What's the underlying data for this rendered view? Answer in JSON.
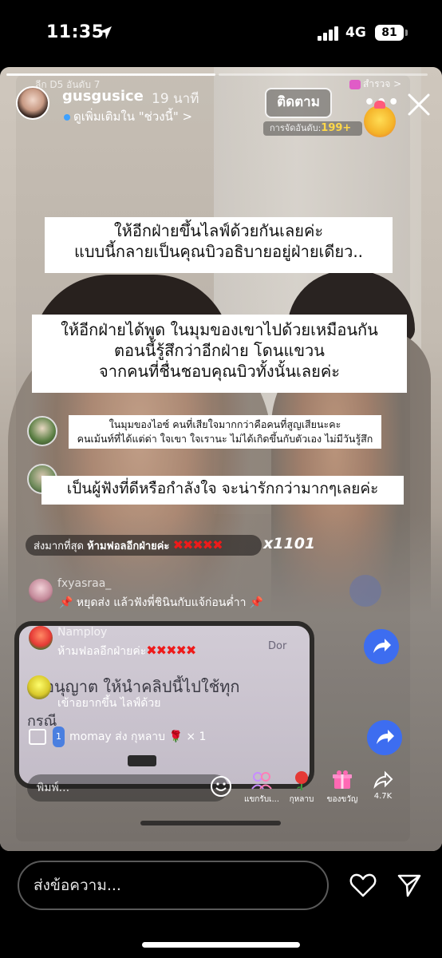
{
  "status_bar": {
    "time": "11:35",
    "network": "4G",
    "battery": "81"
  },
  "story": {
    "username": "gusgusice",
    "time_ago": "19 นาที",
    "subtitle": "ดูเพิ่มเติมใน \"ช่วงนี้\" >",
    "close_label": "×"
  },
  "live": {
    "league_ghost": "ลีก D5 อันดับ 7",
    "explore_label": "สำรวจ >",
    "follow_label": "ติดตาม",
    "more_label": "•••",
    "rank_label": "การจัดอันดับ:",
    "rank_value": "199+",
    "captions": [
      "ให้อีกฝ่ายขึ้นไลฟ์ด้วยกันเลยค่ะ\nแบบนี้กลายเป็นคุณบิวอธิบายอยู่ฝ่ายเดียว..",
      "ให้อีกฝ่ายได้พูด ในมุมของเขาไปด้วยเหมือนกัน\nตอนนี้รู้สึกว่าอีกฝ่าย โดนแขวน\nจากคนที่ชื่นชอบคุณบิวทั้งนั้นเลยค่ะ",
      "ในมุมของไอซ์ คนที่เสียใจมากกว่าคือคนที่สูญเสียนะคะ\nคนเม้นท์ที่ได้แต่ด่า ใจเขา ใจเรานะ ไม่ได้เกิดขึ้นกับตัวเอง ไม่มีวันรู้สึก",
      "เป็นผู้ฟังที่ดีหรือกำลังใจ จะน่ารักกว่ามากๆเลยค่ะ"
    ],
    "gift_banner": {
      "prefix": "ส่งมากที่สุด",
      "text": "ห้ามฟอลอีกฝ่ายค่ะ",
      "xs": "✖✖✖✖✖",
      "count": "x1101"
    },
    "comments": [
      {
        "name": "fxyasraa_",
        "text": "หยุดส่ง แล้วฟังพี่ชินินกับแจ้ก่อนค่ำา"
      },
      {
        "name": "Namploy",
        "text": "ห้ามฟอลอีกฝ่ายค่ะ",
        "xs": "✖✖✖✖✖"
      },
      {
        "name": "",
        "text": "เข้าอยากขึ้น ไลฟ์ด้วย"
      }
    ],
    "phone_screen": {
      "line1": "อนุญาต ให้นำคลิปนี้ไปใช้ทุก",
      "line2": "กรณี",
      "corner": "Dor"
    },
    "gift_line": {
      "level": "1",
      "text": "momay ส่ง กุหลาบ",
      "count": "× 1"
    },
    "input_placeholder": "พิมพ์...",
    "tools": [
      {
        "label": "แขกรับเ...",
        "icon": "guests-icon"
      },
      {
        "label": "กุหลาบ",
        "icon": "rose-icon"
      },
      {
        "label": "ของขวัญ",
        "icon": "gift-icon"
      },
      {
        "label": "4.7K",
        "icon": "share-arrow-icon"
      }
    ]
  },
  "reply": {
    "placeholder": "ส่งข้อความ..."
  },
  "colors": {
    "share_blue": "#3d6df0",
    "x_red": "#ee1a1a",
    "rank_yellow": "#ffd84a"
  }
}
